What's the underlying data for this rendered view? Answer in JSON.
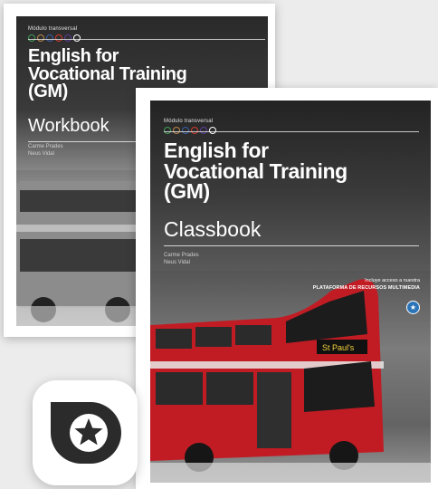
{
  "workbook": {
    "module_label": "Módulo transversal",
    "title_lines": [
      "English for",
      "Vocational Training",
      "(GM)"
    ],
    "subtitle": "Workbook",
    "authors": [
      "Carme Prades",
      "Neus Vidal"
    ]
  },
  "classbook": {
    "module_label": "Módulo transversal",
    "title_lines": [
      "English for",
      "Vocational Training",
      "(GM)"
    ],
    "subtitle": "Classbook",
    "authors": [
      "Carme Prades",
      "Neus Vidal"
    ],
    "promo_line1": "Incluye acceso a nuestra",
    "promo_line2": "PLATAFORMA DE RECURSOS MULTIMEDIA",
    "bus_destination": "St Paul's"
  },
  "module_dot_colors": [
    "#3f9c5a",
    "#b9874b",
    "#3b5fa8",
    "#cf3a2c",
    "#5a3d9a",
    "#ffffff"
  ],
  "icons": {
    "promo": "star-badge-icon",
    "logo": "star-speech-bubble-icon"
  }
}
